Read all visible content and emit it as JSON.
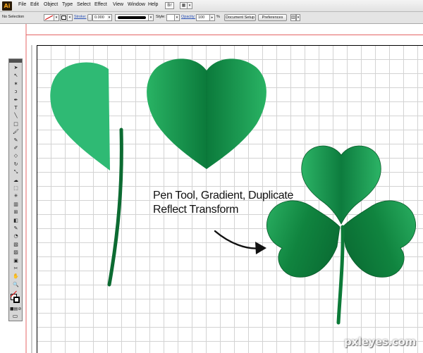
{
  "app": {
    "logo_text": "Ai"
  },
  "menubar": {
    "items": [
      "File",
      "Edit",
      "Object",
      "Type",
      "Select",
      "Effect",
      "View",
      "Window",
      "Help"
    ],
    "icons": [
      "bridge-icon",
      "arrange-documents-icon"
    ]
  },
  "controlbar": {
    "selection_label": "No Selection",
    "stroke_label": "Stroke:",
    "stroke_weight": "0.000",
    "style_label": "Style:",
    "opacity_label": "Opacity:",
    "opacity_value": "100",
    "opacity_unit": "%",
    "document_setup_label": "Document Setup",
    "preferences_label": "Preferences"
  },
  "toolbox": {
    "tools": [
      "selection-tool-icon",
      "direct-selection-tool-icon",
      "magic-wand-tool-icon",
      "lasso-tool-icon",
      "pen-tool-icon",
      "type-tool-icon",
      "line-segment-tool-icon",
      "rectangle-tool-icon",
      "paintbrush-tool-icon",
      "pencil-tool-icon",
      "blob-brush-tool-icon",
      "eraser-tool-icon",
      "rotate-tool-icon",
      "scale-tool-icon",
      "warp-tool-icon",
      "free-transform-tool-icon",
      "symbol-sprayer-tool-icon",
      "column-graph-tool-icon",
      "mesh-tool-icon",
      "gradient-tool-icon",
      "eyedropper-tool-icon",
      "blend-tool-icon",
      "live-paint-bucket-tool-icon",
      "live-paint-selection-tool-icon",
      "artboard-tool-icon",
      "slice-tool-icon",
      "hand-tool-icon",
      "zoom-tool-icon"
    ]
  },
  "colors": {
    "light_leaf": "#2fba74",
    "dark_green": "#0d7a3e",
    "mid_green": "#149a4e",
    "highlight_green": "#29b364",
    "stem": "#0c6b32"
  },
  "annotation": {
    "line1": "Pen Tool, Gradient, Duplicate",
    "line2": "Reflect Transform"
  },
  "watermark": "pxleyes.com"
}
